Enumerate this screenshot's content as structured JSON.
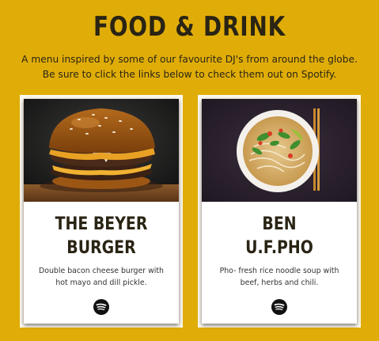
{
  "page": {
    "title": "FOOD & DRINK",
    "intro": "A menu inspired by some of our favourite DJ's from around the globe. Be sure to click the links below to check them out on Spotify."
  },
  "colors": {
    "background": "#e0ad08",
    "text": "#2a2414",
    "card": "#ffffff"
  },
  "menu": {
    "items": [
      {
        "name_line1": "THE BEYER",
        "name_line2": "BURGER",
        "description": "Double bacon cheese burger with hot mayo and dill pickle.",
        "link_icon": "spotify-icon"
      },
      {
        "name_line1": "BEN",
        "name_line2": "U.F.PHO",
        "description": "Pho- fresh rice noodle soup with beef, herbs and chili.",
        "link_icon": "spotify-icon"
      }
    ]
  }
}
